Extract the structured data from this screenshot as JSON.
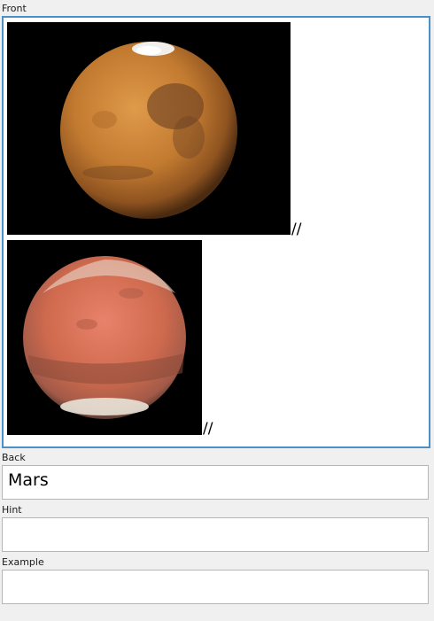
{
  "front": {
    "label": "Front",
    "images": [
      {
        "name": "mars-image-1",
        "separator": "//"
      },
      {
        "name": "mars-image-2",
        "separator": "//"
      }
    ]
  },
  "back": {
    "label": "Back",
    "value": "Mars"
  },
  "hint": {
    "label": "Hint",
    "value": ""
  },
  "example": {
    "label": "Example",
    "value": ""
  }
}
